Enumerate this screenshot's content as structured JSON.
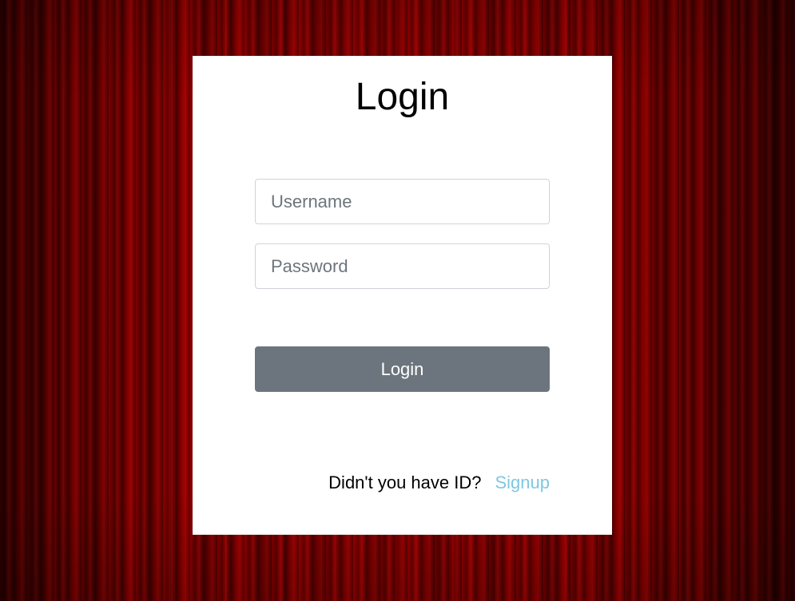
{
  "login_card": {
    "title": "Login",
    "username_placeholder": "Username",
    "password_placeholder": "Password",
    "login_button_label": "Login",
    "signup_prompt": "Didn't you have ID?",
    "signup_link_label": "Signup"
  },
  "colors": {
    "curtain": "#a80000",
    "card_background": "#ffffff",
    "button_background": "#6c757d",
    "link": "#7ec8e3"
  }
}
